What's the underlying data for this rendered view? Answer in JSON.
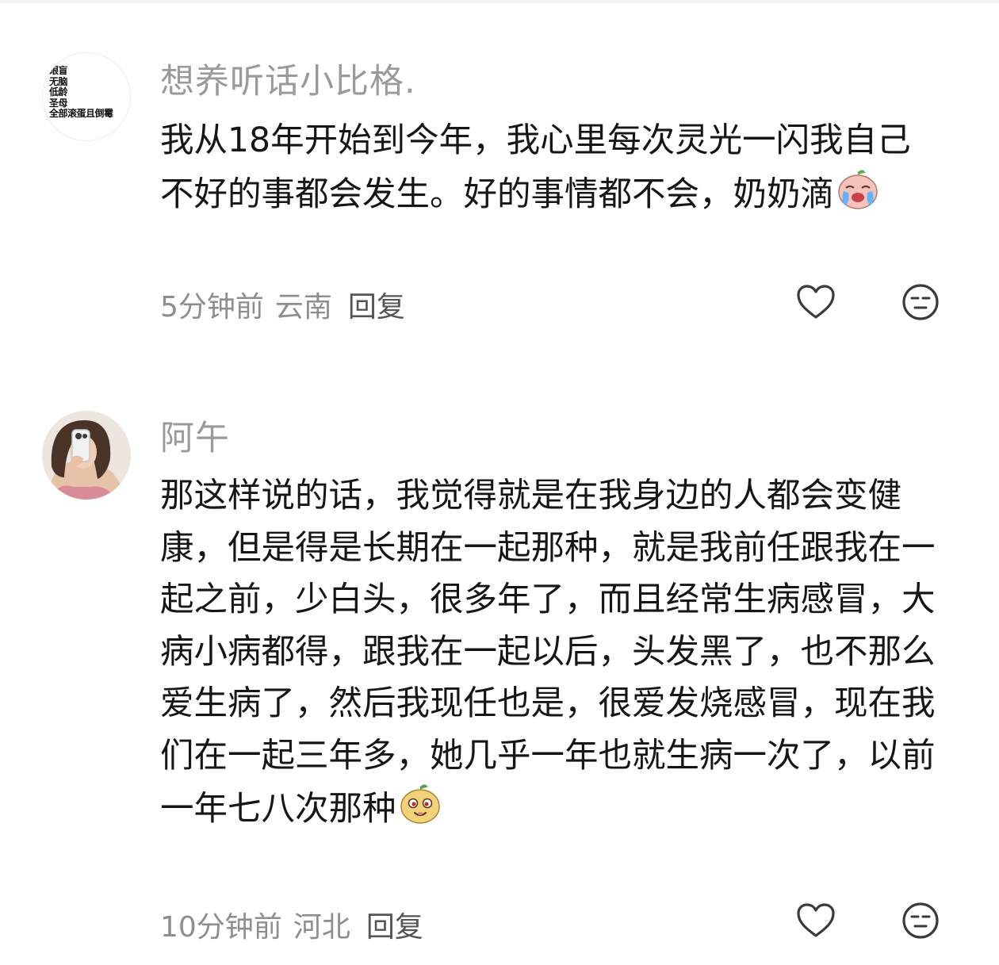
{
  "comments": [
    {
      "avatar_text": [
        "眼盲",
        "无脑",
        "低龄",
        "圣母",
        "全部滚蛋且倒霉"
      ],
      "username": "想养听话小比格.",
      "text": "我从18年开始到今年，我心里每次灵光一闪我自己不好的事都会发生。好的事情都不会，奶奶滴",
      "emoji": "crying-face-emoji",
      "time": "5分钟前",
      "location": "云南",
      "reply_label": "回复"
    },
    {
      "avatar": "user-photo-avatar",
      "username": "阿午",
      "text": "那这样说的话，我觉得就是在我身边的人都会变健康，但是得是长期在一起那种，就是我前任跟我在一起之前，少白头，很多年了，而且经常生病感冒，大病小病都得，跟我在一起以后，头发黑了，也不那么爱生病了，然后我现任也是，很爱发烧感冒，现在我们在一起三年多，她几乎一年也就生病一次了，以前一年七八次那种",
      "emoji": "smug-face-emoji",
      "time": "10分钟前",
      "location": "河北",
      "reply_label": "回复"
    }
  ],
  "icons": {
    "like": "heart-icon",
    "dislike": "neutral-face-icon"
  },
  "colors": {
    "username": "#9a9a9a",
    "body": "#161616",
    "meta": "#8e8e8e"
  }
}
